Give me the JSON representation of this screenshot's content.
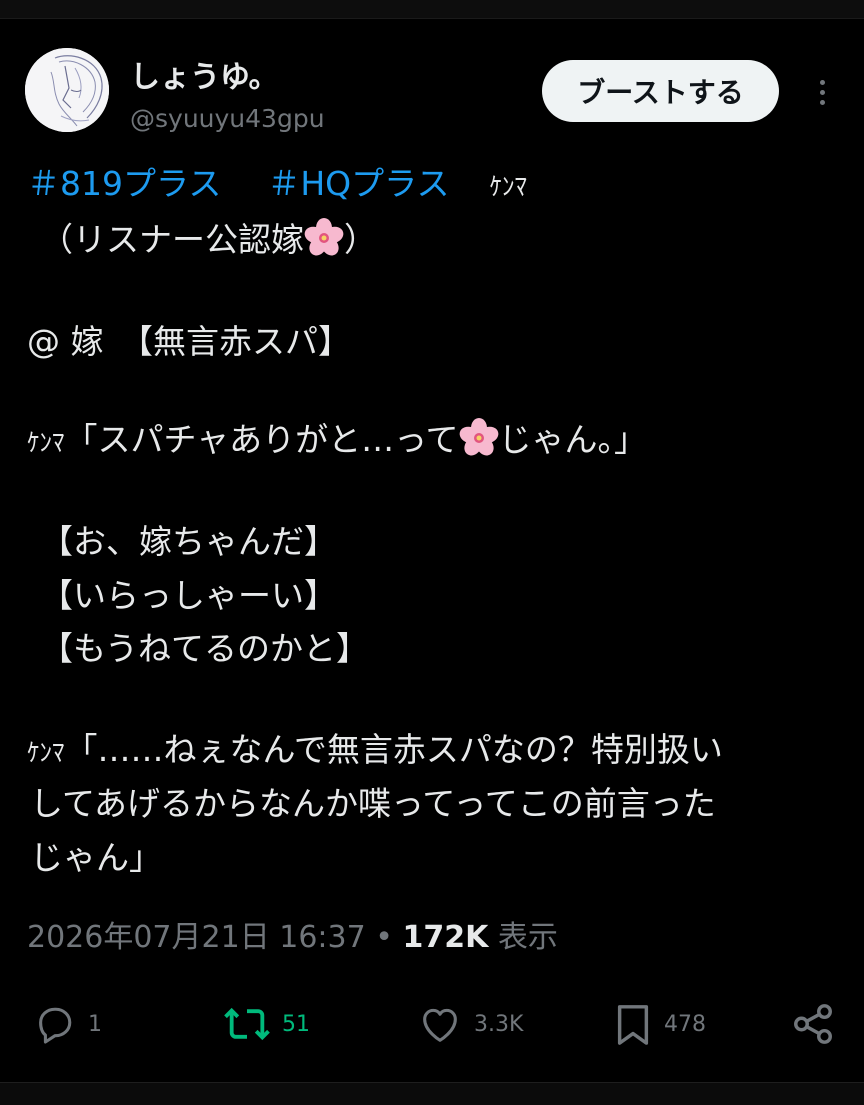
{
  "post": {
    "author": {
      "display_name": "しょうゆ。",
      "handle": "@syuuyu43gpu"
    },
    "boost_label": "ブーストする",
    "text": {
      "hashtag_1": "＃819プラス",
      "hashtag_2": "＃HQプラス",
      "name_tag": "ｹﾝﾏ",
      "line2_a": "（リスナー公認嫁",
      "line2_b": "）",
      "line3": "@ 嫁　【無言赤スパ】",
      "line4_kana": "ｹﾝﾏ",
      "line4_a": "「スパチャありがと…って",
      "line4_b": "じゃん。」",
      "line5": "【お、嫁ちゃんだ】",
      "line6": "【いらっしゃーい】",
      "line7": "【もうねてるのかと】",
      "line8_kana": "ｹﾝﾏ",
      "line8_a": "「……ねぇなんで無言赤スパなの？特別扱い",
      "line9": "してあげるからなんか喋ってってこの前言った",
      "line10": "じゃん」"
    },
    "timestamp": "2026年07月21日 16:37",
    "separator": "•",
    "views_count": "172K",
    "views_label": "表示",
    "actions": {
      "replies": "1",
      "retweets": "51",
      "likes": "3.3K",
      "bookmarks": "478"
    }
  },
  "colors": {
    "background": "#000000",
    "text": "#e7e9ea",
    "secondary": "#71767b",
    "hashtag": "#1d9bf0",
    "retweet_active": "#00ba7c",
    "button_bg": "#eff3f4"
  },
  "icons": [
    "reply-icon",
    "retweet-icon",
    "like-icon",
    "bookmark-icon",
    "share-icon",
    "more-icon",
    "cherry-blossom-emoji"
  ]
}
